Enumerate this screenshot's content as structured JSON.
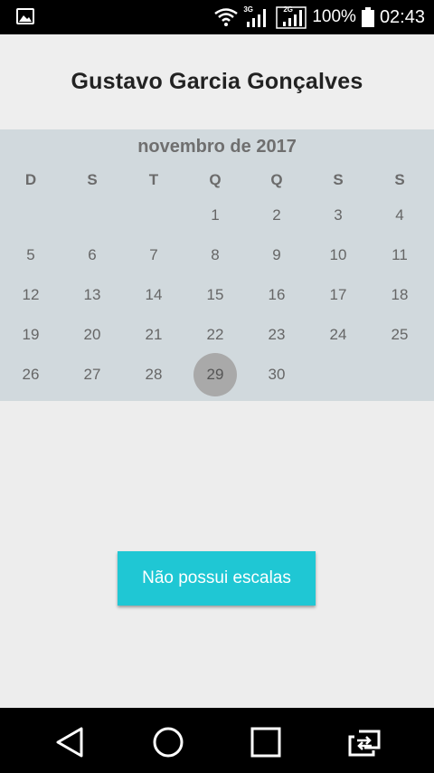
{
  "status_bar": {
    "battery_percent": "100%",
    "time": "02:43",
    "network_1": "3G",
    "network_2": "2G",
    "icons": [
      "gallery-icon",
      "wifi-icon",
      "signal-icon",
      "battery-icon"
    ]
  },
  "header": {
    "title": "Gustavo Garcia Gonçalves"
  },
  "calendar": {
    "month_label": "novembro de 2017",
    "weekdays": [
      "D",
      "S",
      "T",
      "Q",
      "Q",
      "S",
      "S"
    ],
    "weeks": [
      [
        "",
        "",
        "",
        "1",
        "2",
        "3",
        "4"
      ],
      [
        "5",
        "6",
        "7",
        "8",
        "9",
        "10",
        "11"
      ],
      [
        "12",
        "13",
        "14",
        "15",
        "16",
        "17",
        "18"
      ],
      [
        "19",
        "20",
        "21",
        "22",
        "23",
        "24",
        "25"
      ],
      [
        "26",
        "27",
        "28",
        "29",
        "30",
        "",
        ""
      ]
    ],
    "selected_day": "29"
  },
  "action": {
    "label": "Não possui escalas"
  },
  "nav_bar": {
    "icons": [
      "back-icon",
      "home-icon",
      "recents-icon",
      "switch-icon"
    ]
  },
  "colors": {
    "accent": "#1fc7d4",
    "calendar_bg": "#d1d9dd",
    "selected_circle": "#a9a9a9"
  }
}
